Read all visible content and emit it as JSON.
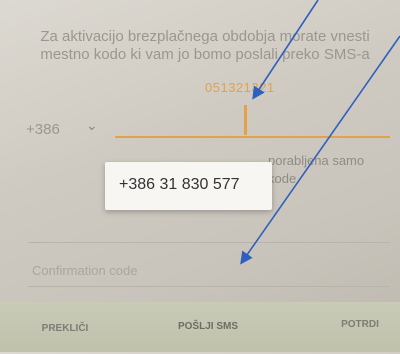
{
  "dialog": {
    "instruction": "Za aktivacijo brezplačnega obdobja morate vnesti mestno kodo ki vam jo bomo poslali preko SMS-a",
    "phone_value": "051321321",
    "country_code": "+386",
    "note": "porabljena samo kode.",
    "suggestion": "+386 31 830 577",
    "code_placeholder": "Confirmation code"
  },
  "buttons": {
    "cancel": "PREKLIČI",
    "send_sms": "POŠLJI SMS",
    "confirm": "POTRDI"
  },
  "colors": {
    "accent": "#e3a14a",
    "annotation_arrow": "#2f5fbf"
  }
}
